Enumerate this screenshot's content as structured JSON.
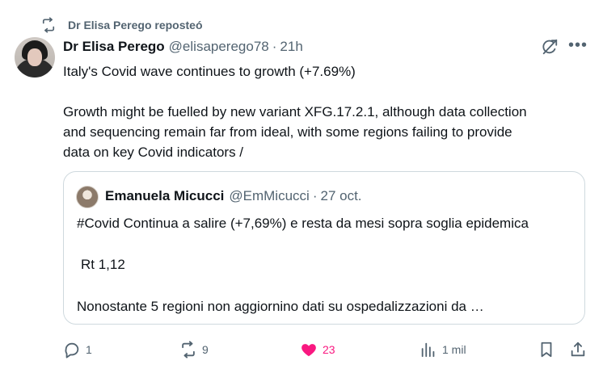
{
  "repost": {
    "label": "Dr Elisa Perego reposteó"
  },
  "post": {
    "author_name": "Dr Elisa Perego",
    "author_handle": "@elisaperego78",
    "separator": "·",
    "time": "21h",
    "line1": "Italy's Covid wave continues to growth (+7.69%)",
    "line2": "Growth might be fuelled by new variant XFG.17.2.1, although data collection",
    "line3": "and sequencing remain far from ideal, with some regions failing to provide",
    "line4": "data on key Covid indicators /"
  },
  "quote": {
    "author_name": "Emanuela Micucci",
    "author_handle": "@EmMicucci",
    "separator": "·",
    "time": "27 oct.",
    "line1": "#Covid Continua a salire (+7,69%) e resta da mesi sopra soglia epidemica",
    "line2": "Rt 1,12",
    "line3": "Nonostante 5 regioni non aggiornino dati su ospedalizzazioni da …"
  },
  "actions": {
    "replies": "1",
    "reposts": "9",
    "likes": "23",
    "views": "1 mil"
  },
  "colors": {
    "secondary_text": "#536471",
    "like": "#f91880",
    "border": "#cfd9de"
  },
  "icons": [
    "repost-icon",
    "grok-icon",
    "more-icon",
    "reply-icon",
    "like-icon",
    "views-icon",
    "bookmark-icon",
    "share-icon"
  ]
}
